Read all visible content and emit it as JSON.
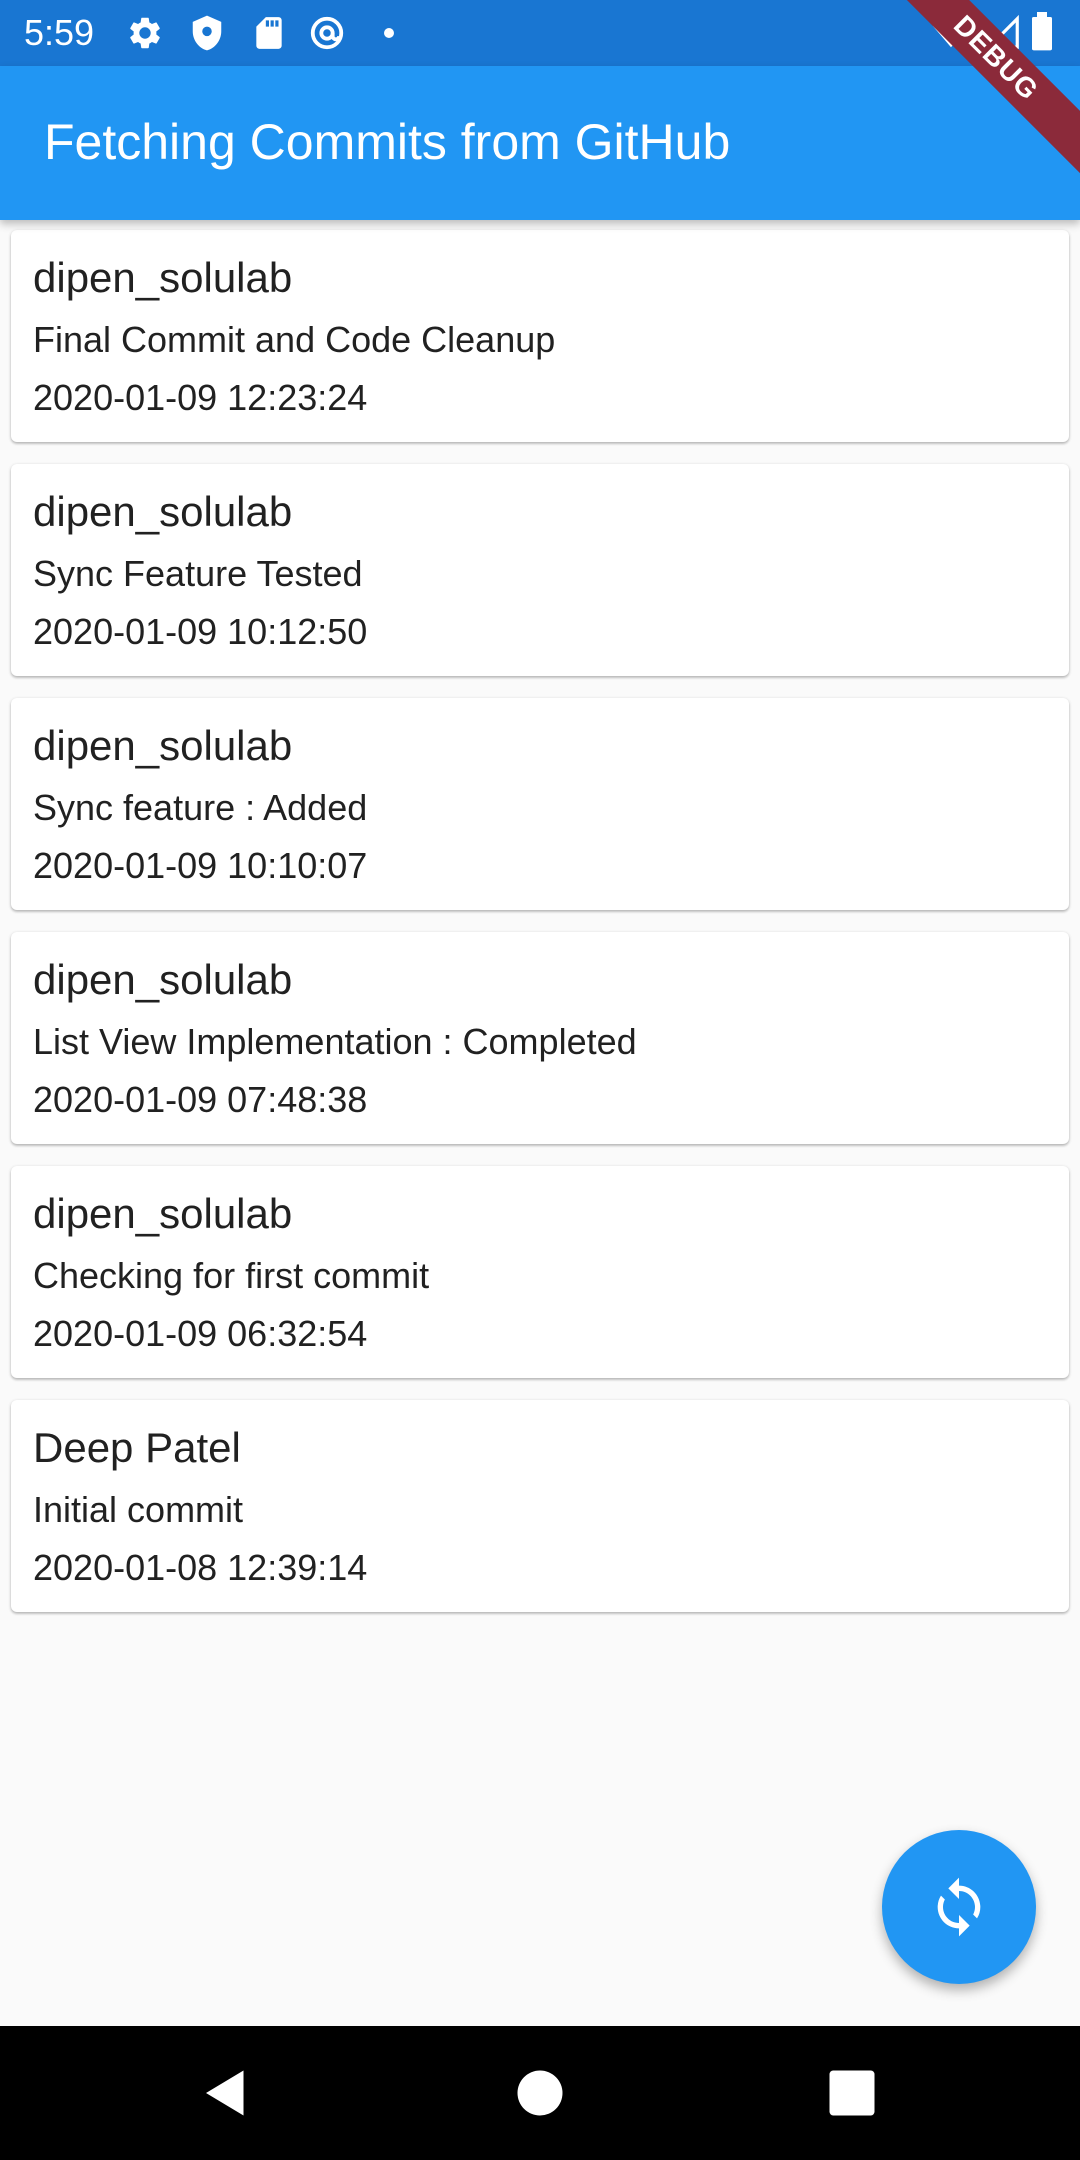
{
  "status_bar": {
    "time": "5:59",
    "icons": [
      "gear-icon",
      "shield-icon",
      "sd-card-icon",
      "at-sign-icon",
      "dot-icon",
      "wifi-icon",
      "signal-icon",
      "battery-icon"
    ]
  },
  "debug_banner": "DEBUG",
  "app_bar": {
    "title": "Fetching Commits from GitHub"
  },
  "commits": [
    {
      "author": "dipen_solulab",
      "message": "Final Commit and Code Cleanup",
      "date": "2020-01-09 12:23:24"
    },
    {
      "author": "dipen_solulab",
      "message": "Sync Feature Tested",
      "date": "2020-01-09 10:12:50"
    },
    {
      "author": "dipen_solulab",
      "message": "Sync feature : Added",
      "date": "2020-01-09 10:10:07"
    },
    {
      "author": "dipen_solulab",
      "message": "List View Implementation : Completed",
      "date": "2020-01-09 07:48:38"
    },
    {
      "author": "dipen_solulab",
      "message": "Checking for first commit",
      "date": "2020-01-09 06:32:54"
    },
    {
      "author": "Deep Patel",
      "message": "Initial commit",
      "date": "2020-01-08 12:39:14"
    }
  ],
  "fab": {
    "icon": "sync-icon"
  },
  "nav_bar": {
    "icons": [
      "back-icon",
      "home-icon",
      "recents-icon"
    ]
  },
  "colors": {
    "status_bar": "#1976d2",
    "app_bar": "#2196f3",
    "fab": "#2196f3",
    "background": "#fafafa",
    "debug_banner": "#8b2a3a"
  }
}
